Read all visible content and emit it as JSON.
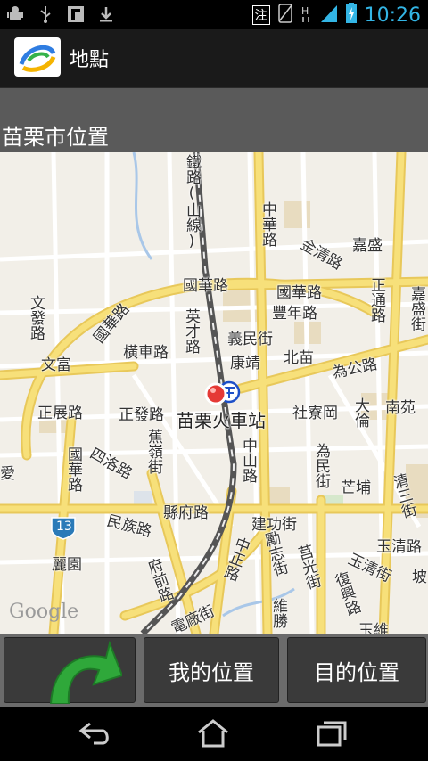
{
  "status_bar": {
    "clock": "10:26",
    "ime_indicator": "注",
    "left_icons": [
      "android-debug-icon",
      "usb-icon",
      "flipboard-icon",
      "download-icon"
    ],
    "right_icons": [
      "no-sim-icon",
      "data-h-icon",
      "signal-icon",
      "battery-charging-icon"
    ]
  },
  "title_bar": {
    "title": "地點"
  },
  "location_header": {
    "text": "苗栗市位置"
  },
  "map": {
    "station_label": "苗栗火車站",
    "attribution": "Google",
    "labels": {
      "railway": "鐵路(山線)",
      "guohua_top": "國華路",
      "guohua_right": "國華路",
      "guohua_left": "國華路",
      "guohua_bottom": "國華路",
      "zhonghua": "中華路",
      "jinqing": "金清路",
      "jiasheng": "嘉盛",
      "zhengtong": "正通路",
      "jiasheng_st": "嘉盛街",
      "fengnian": "豐年路",
      "yingcai": "英才路",
      "hengling": "橫車路",
      "yimin": "義民街",
      "kangjing": "康靖",
      "beimiao": "北苗",
      "weigong": "為公路",
      "wenfa": "文發路",
      "wenfu": "文富",
      "zhengzhan": "正展路",
      "zhengfa": "正發路",
      "jiaoling": "蕉嶺街",
      "shequ": "社寮岡",
      "danan": "大倫",
      "nanyuan": "南苑",
      "weimin": "為民街",
      "mangbu": "芒埔",
      "zhongshan": "中山路",
      "sishui": "四洛路",
      "xianfu": "縣府路",
      "minzu": "民族路",
      "jiangong": "建功街",
      "qingsan": "清三街",
      "yuqing": "玉清路",
      "yuqing_st": "玉清街",
      "lijiyuan": "麗園",
      "fuqian": "府前路",
      "zhongzheng": "中正路",
      "lizhi": "勵志街",
      "gongguang": "莒光街",
      "fuxing": "復興路",
      "weisheng": "維勝",
      "dianchang": "電廠街",
      "road_13": "13",
      "po": "坡",
      "ai": "愛",
      "liwu": "玉維"
    }
  },
  "bottom_bar": {
    "back_icon": "green-curved-back-arrow-icon",
    "my_location_label": "我的位置",
    "destination_label": "目的位置"
  },
  "nav_bar": {
    "icons": [
      "back-icon",
      "home-icon",
      "recent-apps-icon"
    ]
  },
  "colors": {
    "status_clock": "#33b5e5",
    "title_bar_bg": "#1a1a1a",
    "header_bg": "#5a5a5a",
    "map_bg": "#f2efe8",
    "major_road": "#f7e07a",
    "railway": "#555555",
    "marker": "#e53935",
    "station_icon": "#1e50c8",
    "back_arrow": "#2fa83a"
  }
}
